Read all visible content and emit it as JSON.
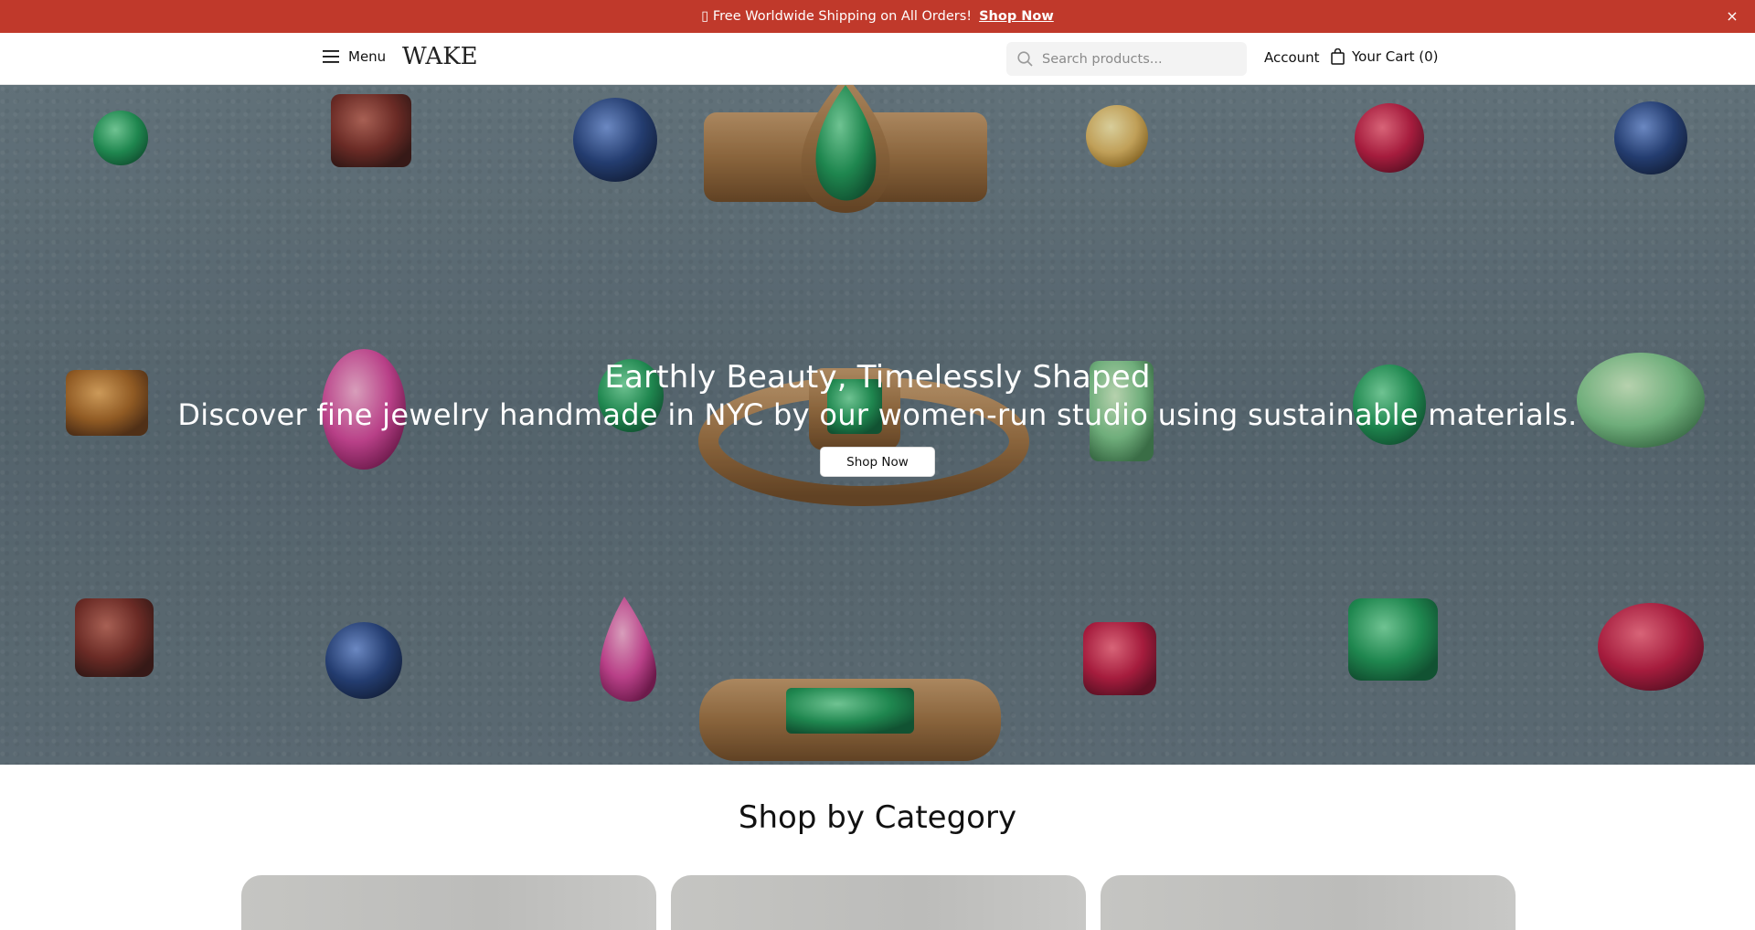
{
  "announcement": {
    "icon": "gift-icon",
    "glyph": "\u0000",
    "text": "Free Worldwide Shipping on All Orders!",
    "link_label": "Shop Now",
    "close_label": "×",
    "background": "#c0392b"
  },
  "header": {
    "menu_label": "Menu",
    "logo": "WAKE",
    "search_placeholder": "Search products...",
    "account_label": "Account",
    "cart_label": "Your Cart (0)"
  },
  "hero": {
    "title": "Earthly Beauty, Timelessly Shaped",
    "subtitle": "Discover fine jewelry handmade in NYC by our women-run studio using sustainable materials.",
    "button_label": "Shop Now"
  },
  "categories": {
    "title": "Shop by Category",
    "cards": 3
  }
}
